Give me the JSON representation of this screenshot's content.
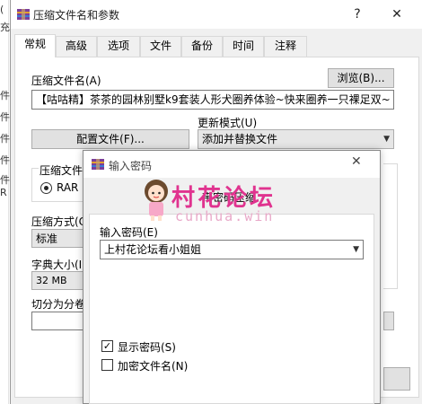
{
  "bg_column": [
    "(",
    "充",
    "件",
    "件",
    "件",
    "件",
    "件",
    "R"
  ],
  "main": {
    "title": "压缩文件名和参数",
    "tabs": [
      "常规",
      "高级",
      "选项",
      "文件",
      "备份",
      "时间",
      "注释"
    ],
    "archive_name_label": "压缩文件名(A)",
    "browse_label": "浏览(B)...",
    "archive_name_value": "【咕咕精】茶茶的园林别墅k9套装人形犬圈养体验~快来圈养一只裸足双~",
    "update_mode_label": "更新模式(U)",
    "update_mode_value": "添加并替换文件",
    "profiles_label": "配置文件(F)...",
    "format_label": "压缩文件",
    "format_rar": "RAR",
    "method_label": "压缩方式(C",
    "method_value": "标准",
    "dict_label": "字典大小(I",
    "dict_value": "32 MB",
    "split_label": "切分为分卷"
  },
  "dialog": {
    "title": "输入密码",
    "subtitle": "带密码压缩",
    "password_label": "输入密码(E)",
    "password_value": "上村花论坛看小姐姐",
    "show_password": "显示密码(S)",
    "show_password_checked": true,
    "encrypt_names": "加密文件名(N)",
    "encrypt_names_checked": false
  },
  "watermark": {
    "title": "村花论坛",
    "sub": "cunhua.win"
  },
  "icons": {
    "app": "winrar-icon",
    "minimize": "minimize-icon",
    "close": "close-icon"
  }
}
